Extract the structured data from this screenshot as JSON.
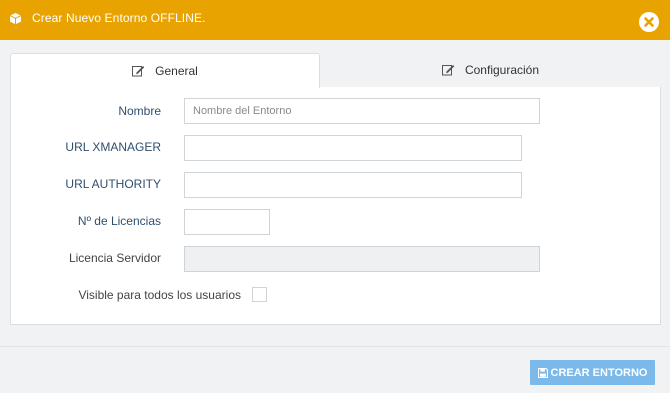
{
  "modal": {
    "title": "Crear Nuevo Entorno OFFLINE.",
    "header_color": "#e8a300"
  },
  "tabs": [
    {
      "label": "General",
      "icon": "edit-icon",
      "active": true
    },
    {
      "label": "Configuración",
      "icon": "edit-icon",
      "active": false
    }
  ],
  "form": {
    "nombre": {
      "label": "Nombre",
      "placeholder": "Nombre del Entorno",
      "value": ""
    },
    "url_xmanager": {
      "label": "URL XMANAGER",
      "value": ""
    },
    "url_authority": {
      "label": "URL AUTHORITY",
      "value": ""
    },
    "licencias": {
      "label": "Nº de Licencias",
      "value": ""
    },
    "licencia_servidor": {
      "label": "Licencia Servidor",
      "value": "",
      "disabled": true
    },
    "visible": {
      "label": "Visible para todos los usuarios",
      "checked": false
    }
  },
  "footer": {
    "submit_label": "CREAR ENTORNO",
    "submit_icon": "save-icon",
    "submit_color": "#7ab9ea"
  }
}
